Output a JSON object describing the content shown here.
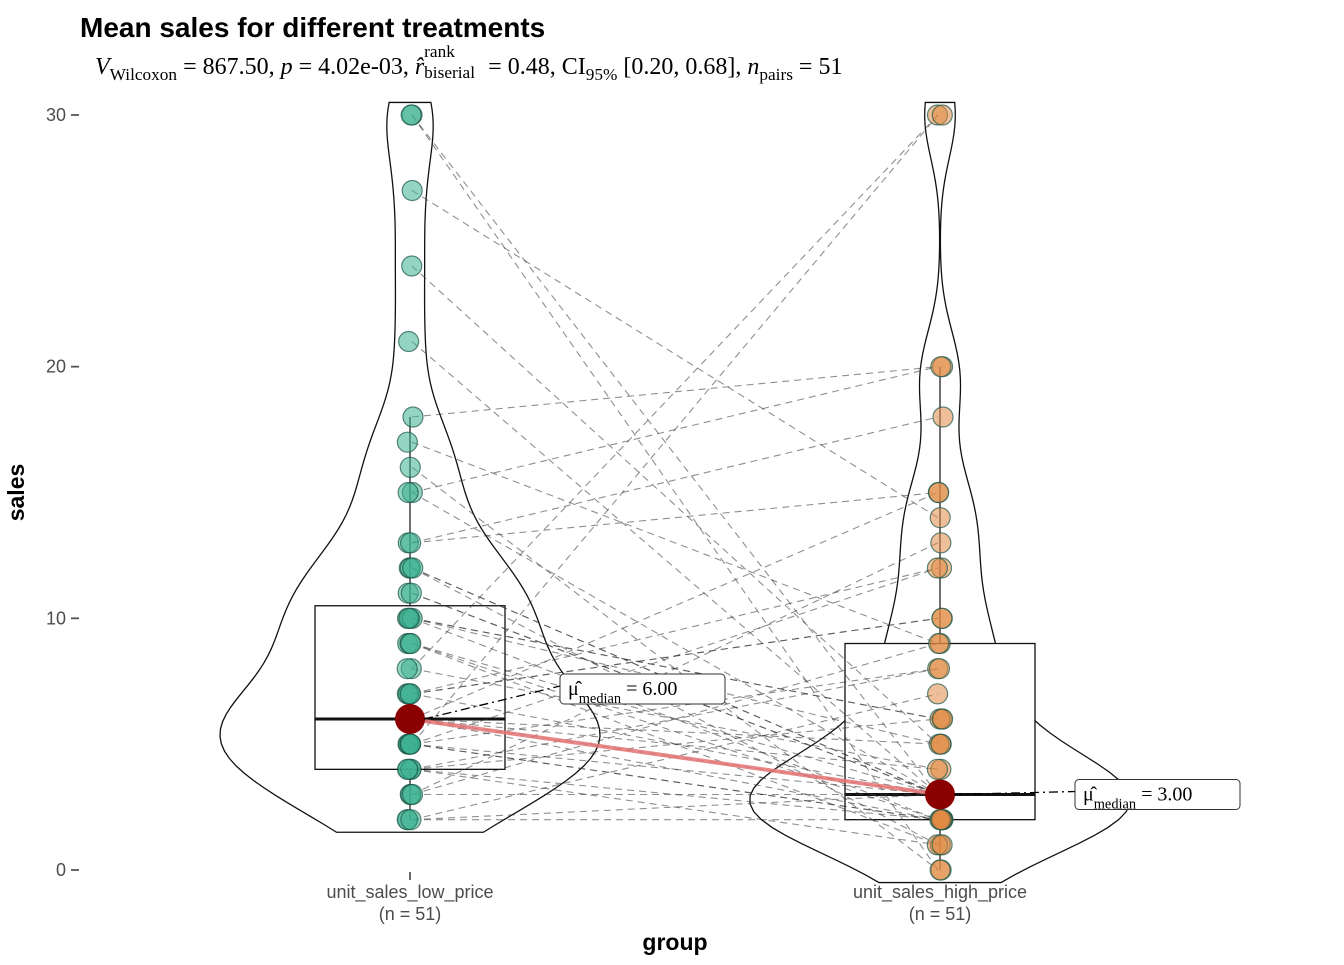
{
  "chart_data": {
    "type": "paired-violin-box-scatter",
    "title": "Mean sales for different treatments",
    "subtitle_parts": {
      "V_label": "V",
      "V_sub": "Wilcoxon",
      "V_value": "867.50",
      "p_label": "p",
      "p_value": "4.02e-03",
      "r_hat": "r̂",
      "r_sup": "rank",
      "r_sub": "biserial",
      "r_value": "0.48",
      "ci_label": "CI",
      "ci_sub": "95%",
      "ci_values": "[0.20, 0.68]",
      "n_label": "n",
      "n_sub": "pairs",
      "n_value": "51"
    },
    "xlabel": "group",
    "ylabel": "sales",
    "ylim": [
      0,
      30
    ],
    "y_ticks": [
      0,
      10,
      20,
      30
    ],
    "groups": [
      {
        "label": "unit_sales_low_price",
        "n": 51,
        "n_label": "(n = 51)",
        "median": 6.0,
        "median_label": "μ̂_median = 6.00",
        "box": {
          "q1": 4.0,
          "median": 6.0,
          "q3": 10.5,
          "whisker_low": 2.0,
          "whisker_high": 18.0
        },
        "color": "#3cb08f",
        "data": [
          2,
          2,
          2,
          3,
          3,
          3,
          4,
          4,
          4,
          4,
          5,
          5,
          5,
          5,
          5,
          5,
          6,
          6,
          6,
          6,
          6,
          7,
          7,
          7,
          7,
          8,
          8,
          9,
          9,
          9,
          10,
          10,
          10,
          10,
          11,
          11,
          12,
          12,
          12,
          13,
          13,
          15,
          15,
          16,
          17,
          18,
          21,
          24,
          27,
          30,
          30
        ]
      },
      {
        "label": "unit_sales_high_price",
        "n": 51,
        "n_label": "(n = 51)",
        "median": 3.0,
        "median_label": "μ̂_median = 3.00",
        "box": {
          "q1": 2.0,
          "median": 3.0,
          "q3": 9.0,
          "whisker_low": 0.0,
          "whisker_high": 20.0
        },
        "color": "#e08b43",
        "data": [
          0,
          0,
          1,
          1,
          1,
          2,
          2,
          2,
          2,
          2,
          2,
          2,
          3,
          3,
          3,
          3,
          3,
          3,
          3,
          3,
          3,
          3,
          3,
          3,
          3,
          4,
          4,
          5,
          5,
          5,
          6,
          6,
          6,
          7,
          8,
          8,
          9,
          9,
          10,
          10,
          12,
          12,
          13,
          14,
          15,
          15,
          18,
          20,
          20,
          30,
          30
        ]
      }
    ],
    "mean_line_color": "#e57373",
    "mean_point_color": "#8b0000",
    "median_labels": {
      "left": "6.00",
      "right": "3.00"
    }
  }
}
